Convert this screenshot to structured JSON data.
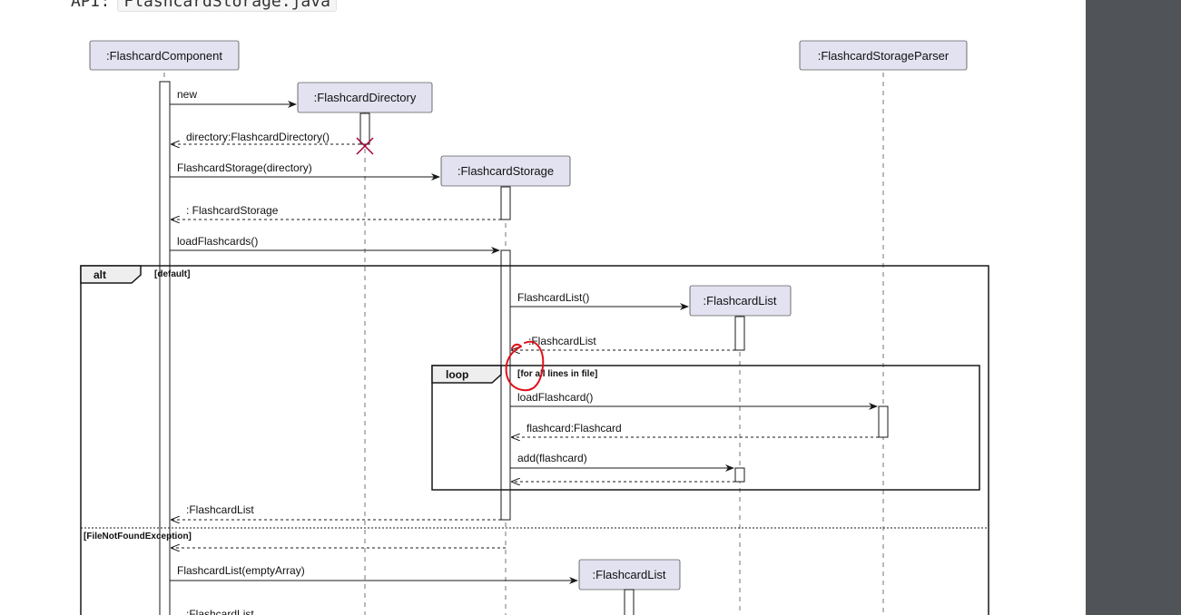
{
  "doc": {
    "api_label": "API:",
    "api_file": "FlashcardStorage.java"
  },
  "diagram": {
    "participants": {
      "component": ":FlashcardComponent",
      "parser": ":FlashcardStorageParser",
      "directory": ":FlashcardDirectory",
      "storage": ":FlashcardStorage",
      "list1": ":FlashcardList",
      "list2": ":FlashcardList"
    },
    "messages": {
      "m1": "new",
      "m2": "directory:FlashcardDirectory()",
      "m3": "FlashcardStorage(directory)",
      "m4": ": FlashcardStorage",
      "m5": "loadFlashcards()",
      "m6": "FlashcardList()",
      "m7": ":FlashcardList",
      "m8": "loadFlashcard()",
      "m9": "flashcard:Flashcard",
      "m10": "add(flashcard)",
      "m11": ":FlashcardList",
      "m12": "FlashcardList(emptyArray)",
      "m13": ":FlashcardList"
    },
    "fragments": {
      "alt_keyword": "alt",
      "alt_guard": "[default]",
      "else_guard": "[FileNotFoundException]",
      "loop_keyword": "loop",
      "loop_guard": "[for all lines in file]"
    },
    "colors": {
      "participant_fill": "#e2e2f0",
      "participant_stroke": "#181818",
      "destroy": "#a80036",
      "annotation": "#e0101a"
    }
  }
}
